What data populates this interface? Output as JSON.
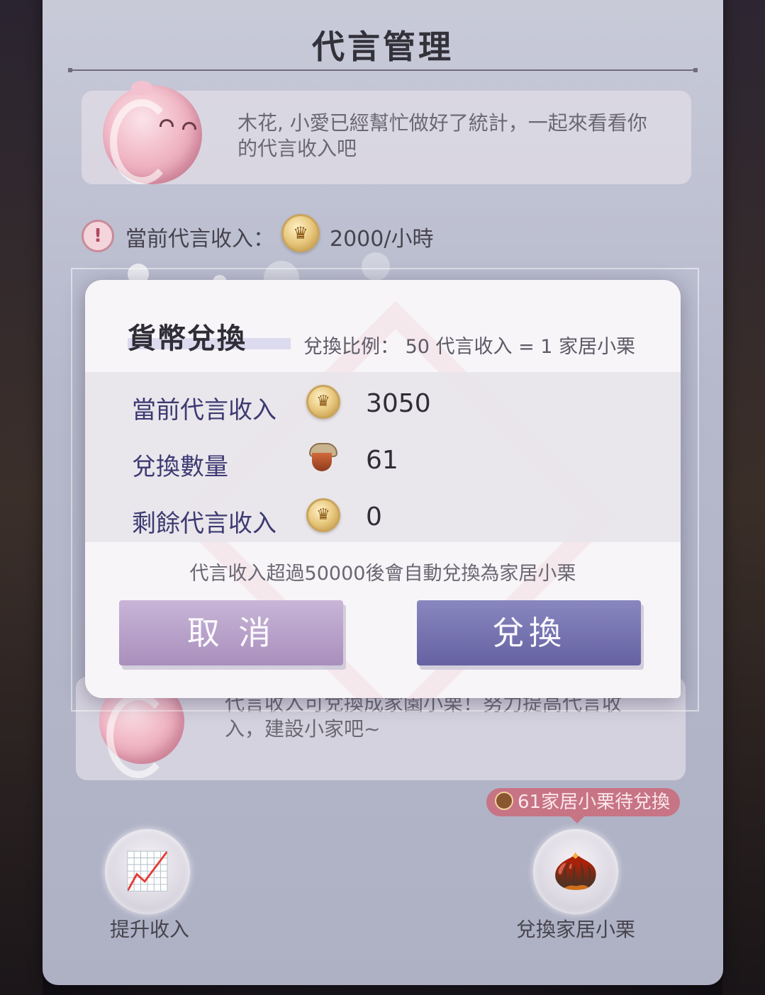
{
  "page": {
    "title": "代言管理",
    "intro_message": "木花, 小愛已經幫忙做好了統計，一起來看看你的代言收入吧",
    "current_income_label": "當前代言收入：",
    "current_income_rate": "2000/小時",
    "tip_message": "代言收入可兌換成家園小栗！努力提高代言收入，建設小家吧~",
    "pending_badge": "61家居小栗待兌換",
    "bottom_buttons": {
      "boost_label": "提升收入",
      "exchange_home_label": "兌換家居小栗"
    }
  },
  "dialog": {
    "title": "貨幣兌換",
    "ratio": "兌換比例：  50 代言收入 = 1 家居小栗",
    "rows": [
      {
        "label": "當前代言收入",
        "icon": "crown-coin-icon",
        "value": "3050"
      },
      {
        "label": "兌換數量",
        "icon": "acorn-icon",
        "value": "61"
      },
      {
        "label": "剩餘代言收入",
        "icon": "crown-coin-icon",
        "value": "0"
      }
    ],
    "note": "代言收入超過50000後會自動兌換為家居小栗",
    "cancel_label": "取 消",
    "confirm_label": "兌換"
  },
  "colors": {
    "panel": "#b9bccd",
    "dialog_bg": "#f7f5f8",
    "stat_label": "#3d3a72",
    "cancel_button": "#b9a3c9",
    "confirm_button": "#7673b0",
    "badge": "#c77485"
  }
}
